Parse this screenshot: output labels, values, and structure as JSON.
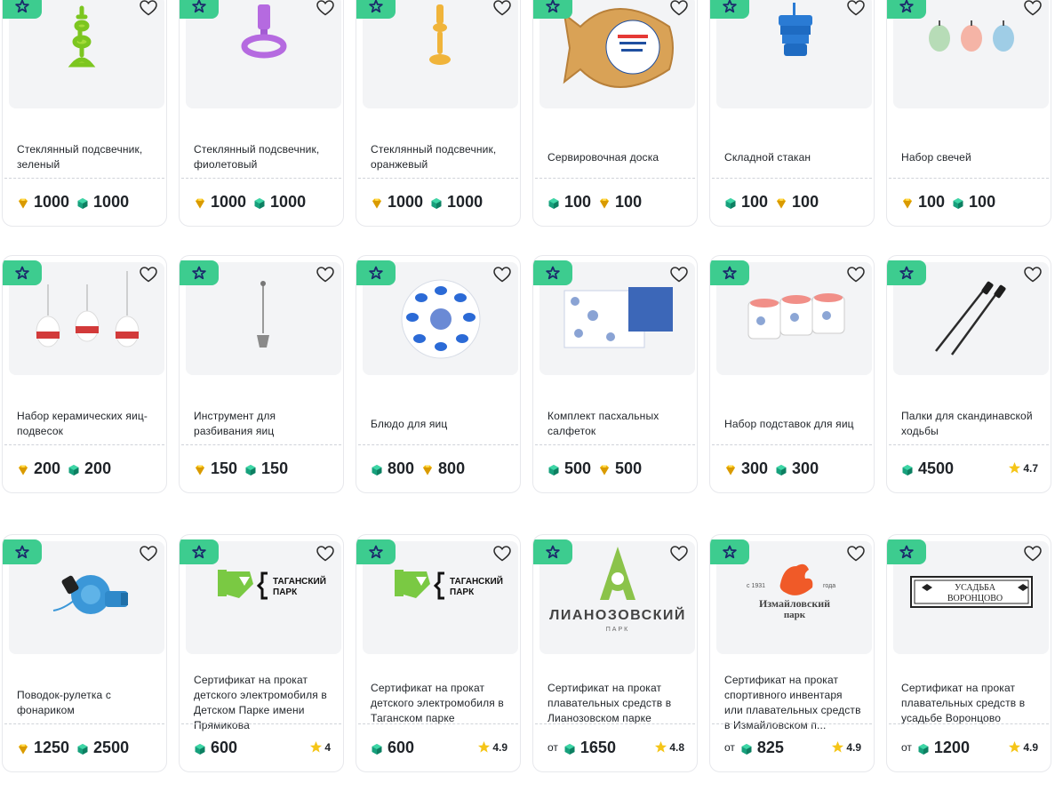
{
  "currency_icons": {
    "gem": "gem-icon",
    "cube": "cube-icon"
  },
  "colors": {
    "accent": "#3dcc8f",
    "gem": "#f2b705",
    "cube": "#17a07c",
    "star": "#f5c518"
  },
  "price_prefix": "от",
  "products": [
    {
      "title": "Стеклянный подсвечник, зеленый",
      "art": "candle-green",
      "prices": [
        {
          "cur": "gem",
          "value": "1000"
        },
        {
          "cur": "cube",
          "value": "1000"
        }
      ]
    },
    {
      "title": "Стеклянный подсвечник, фиолетовый",
      "art": "candle-purple",
      "prices": [
        {
          "cur": "gem",
          "value": "1000"
        },
        {
          "cur": "cube",
          "value": "1000"
        }
      ]
    },
    {
      "title": "Стеклянный подсвечник, оранжевый",
      "art": "candle-orange",
      "prices": [
        {
          "cur": "gem",
          "value": "1000"
        },
        {
          "cur": "cube",
          "value": "1000"
        }
      ]
    },
    {
      "title": "Сервировочная доска",
      "art": "fish-board",
      "prices": [
        {
          "cur": "cube",
          "value": "100"
        },
        {
          "cur": "gem",
          "value": "100"
        }
      ]
    },
    {
      "title": "Складной стакан",
      "art": "cup",
      "prices": [
        {
          "cur": "cube",
          "value": "100"
        },
        {
          "cur": "gem",
          "value": "100"
        }
      ]
    },
    {
      "title": "Набор свечей",
      "art": "candles",
      "prices": [
        {
          "cur": "gem",
          "value": "100"
        },
        {
          "cur": "cube",
          "value": "100"
        }
      ]
    },
    {
      "title": "Набор керамических яиц-подвесок",
      "art": "eggs",
      "prices": [
        {
          "cur": "gem",
          "value": "200"
        },
        {
          "cur": "cube",
          "value": "200"
        }
      ]
    },
    {
      "title": "Инструмент для разбивания яиц",
      "art": "tool",
      "prices": [
        {
          "cur": "gem",
          "value": "150"
        },
        {
          "cur": "cube",
          "value": "150"
        }
      ]
    },
    {
      "title": "Блюдо для яиц",
      "art": "plate",
      "prices": [
        {
          "cur": "cube",
          "value": "800"
        },
        {
          "cur": "gem",
          "value": "800"
        }
      ]
    },
    {
      "title": "Комплект пасхальных салфеток",
      "art": "napkins",
      "prices": [
        {
          "cur": "cube",
          "value": "500"
        },
        {
          "cur": "gem",
          "value": "500"
        }
      ]
    },
    {
      "title": "Набор подставок для яиц",
      "art": "egg-cups",
      "prices": [
        {
          "cur": "gem",
          "value": "300"
        },
        {
          "cur": "cube",
          "value": "300"
        }
      ]
    },
    {
      "title": "Палки для скандинавской ходьбы",
      "art": "poles",
      "prices": [
        {
          "cur": "cube",
          "value": "4500"
        }
      ],
      "rating": "4.7"
    },
    {
      "title": "Поводок-рулетка с фонариком",
      "art": "leash",
      "prices": [
        {
          "cur": "gem",
          "value": "1250"
        },
        {
          "cur": "cube",
          "value": "2500"
        }
      ]
    },
    {
      "title": "Сертификат на прокат детского электромобиля в Детском Парке имени Прямикова",
      "art": "tagansky",
      "logo_text": "ТАГАНСКИЙ ПАРК",
      "prices": [
        {
          "cur": "cube",
          "value": "600"
        }
      ],
      "rating": "4"
    },
    {
      "title": "Сертификат на прокат детского электромобиля в Таганском парке",
      "art": "tagansky",
      "logo_text": "ТАГАНСКИЙ ПАРК",
      "prices": [
        {
          "cur": "cube",
          "value": "600"
        }
      ],
      "rating": "4.9"
    },
    {
      "title": "Сертификат на прокат плавательных средств в Лианозовском парке",
      "art": "lianozovo",
      "logo_text": "ЛИАНОЗОВСКИЙ",
      "logo_sub": "ПАРК",
      "from": true,
      "prices": [
        {
          "cur": "cube",
          "value": "1650"
        }
      ],
      "rating": "4.8"
    },
    {
      "title": "Сертификат на прокат спортивного инвентаря или плавательных средств в Измайловском п...",
      "art": "izmailovo",
      "logo_text": "Измайловский",
      "logo_sub": "парк",
      "logo_year_left": "с 1931",
      "logo_year_right": "года",
      "from": true,
      "prices": [
        {
          "cur": "cube",
          "value": "825"
        }
      ],
      "rating": "4.9"
    },
    {
      "title": "Сертификат на прокат плавательных средств в усадьбе Воронцово",
      "art": "vorontsovo",
      "logo_text": "УСАДЬБА",
      "logo_sub": "ВОРОНЦОВО",
      "from": true,
      "prices": [
        {
          "cur": "cube",
          "value": "1200"
        }
      ],
      "rating": "4.9"
    }
  ]
}
